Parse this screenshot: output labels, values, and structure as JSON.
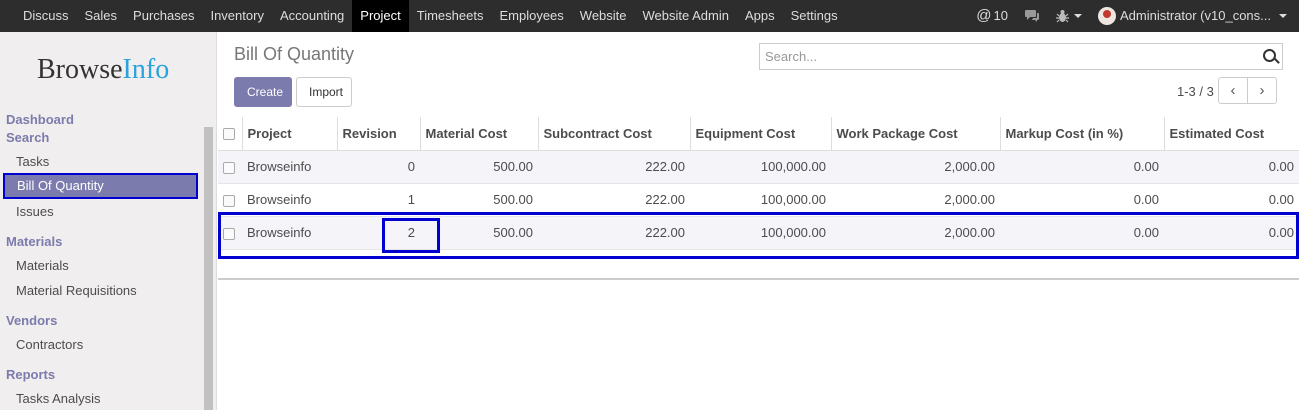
{
  "topbar": {
    "menu": [
      "Discuss",
      "Sales",
      "Purchases",
      "Inventory",
      "Accounting",
      "Project",
      "Timesheets",
      "Employees",
      "Website",
      "Website Admin",
      "Apps",
      "Settings"
    ],
    "active_menu": "Project",
    "mentions_count": "10",
    "user": "Administrator (v10_cons..."
  },
  "sidebar": {
    "logo_main": "Browse",
    "logo_accent": "Info",
    "sections": [
      {
        "heading": "Dashboard"
      },
      {
        "heading": "Search",
        "items": [
          "Tasks",
          "Bill Of Quantity",
          "Issues"
        ]
      },
      {
        "heading": "Materials",
        "items": [
          "Materials",
          "Material Requisitions"
        ]
      },
      {
        "heading": "Vendors",
        "items": [
          "Contractors"
        ]
      },
      {
        "heading": "Reports",
        "items": [
          "Tasks Analysis"
        ]
      }
    ],
    "active_item": "Bill Of Quantity"
  },
  "control_panel": {
    "title": "Bill Of Quantity",
    "create_label": "Create",
    "import_label": "Import",
    "search_placeholder": "Search...",
    "pager": "1-3 / 3",
    "pager_prev": "‹",
    "pager_next": "›"
  },
  "table": {
    "columns": [
      "Project",
      "Revision",
      "Material Cost",
      "Subcontract Cost",
      "Equipment Cost",
      "Work Package Cost",
      "Markup Cost (in %)",
      "Estimated Cost"
    ],
    "rows": [
      [
        "Browseinfo",
        "0",
        "500.00",
        "222.00",
        "100,000.00",
        "2,000.00",
        "0.00",
        "0.00"
      ],
      [
        "Browseinfo",
        "1",
        "500.00",
        "222.00",
        "100,000.00",
        "2,000.00",
        "0.00",
        "0.00"
      ],
      [
        "Browseinfo",
        "2",
        "500.00",
        "222.00",
        "100,000.00",
        "2,000.00",
        "0.00",
        "0.00"
      ]
    ]
  },
  "colors": {
    "accent": "#7c7bad",
    "highlight_border": "#0000d0",
    "navbar": "#2d2d2d"
  }
}
